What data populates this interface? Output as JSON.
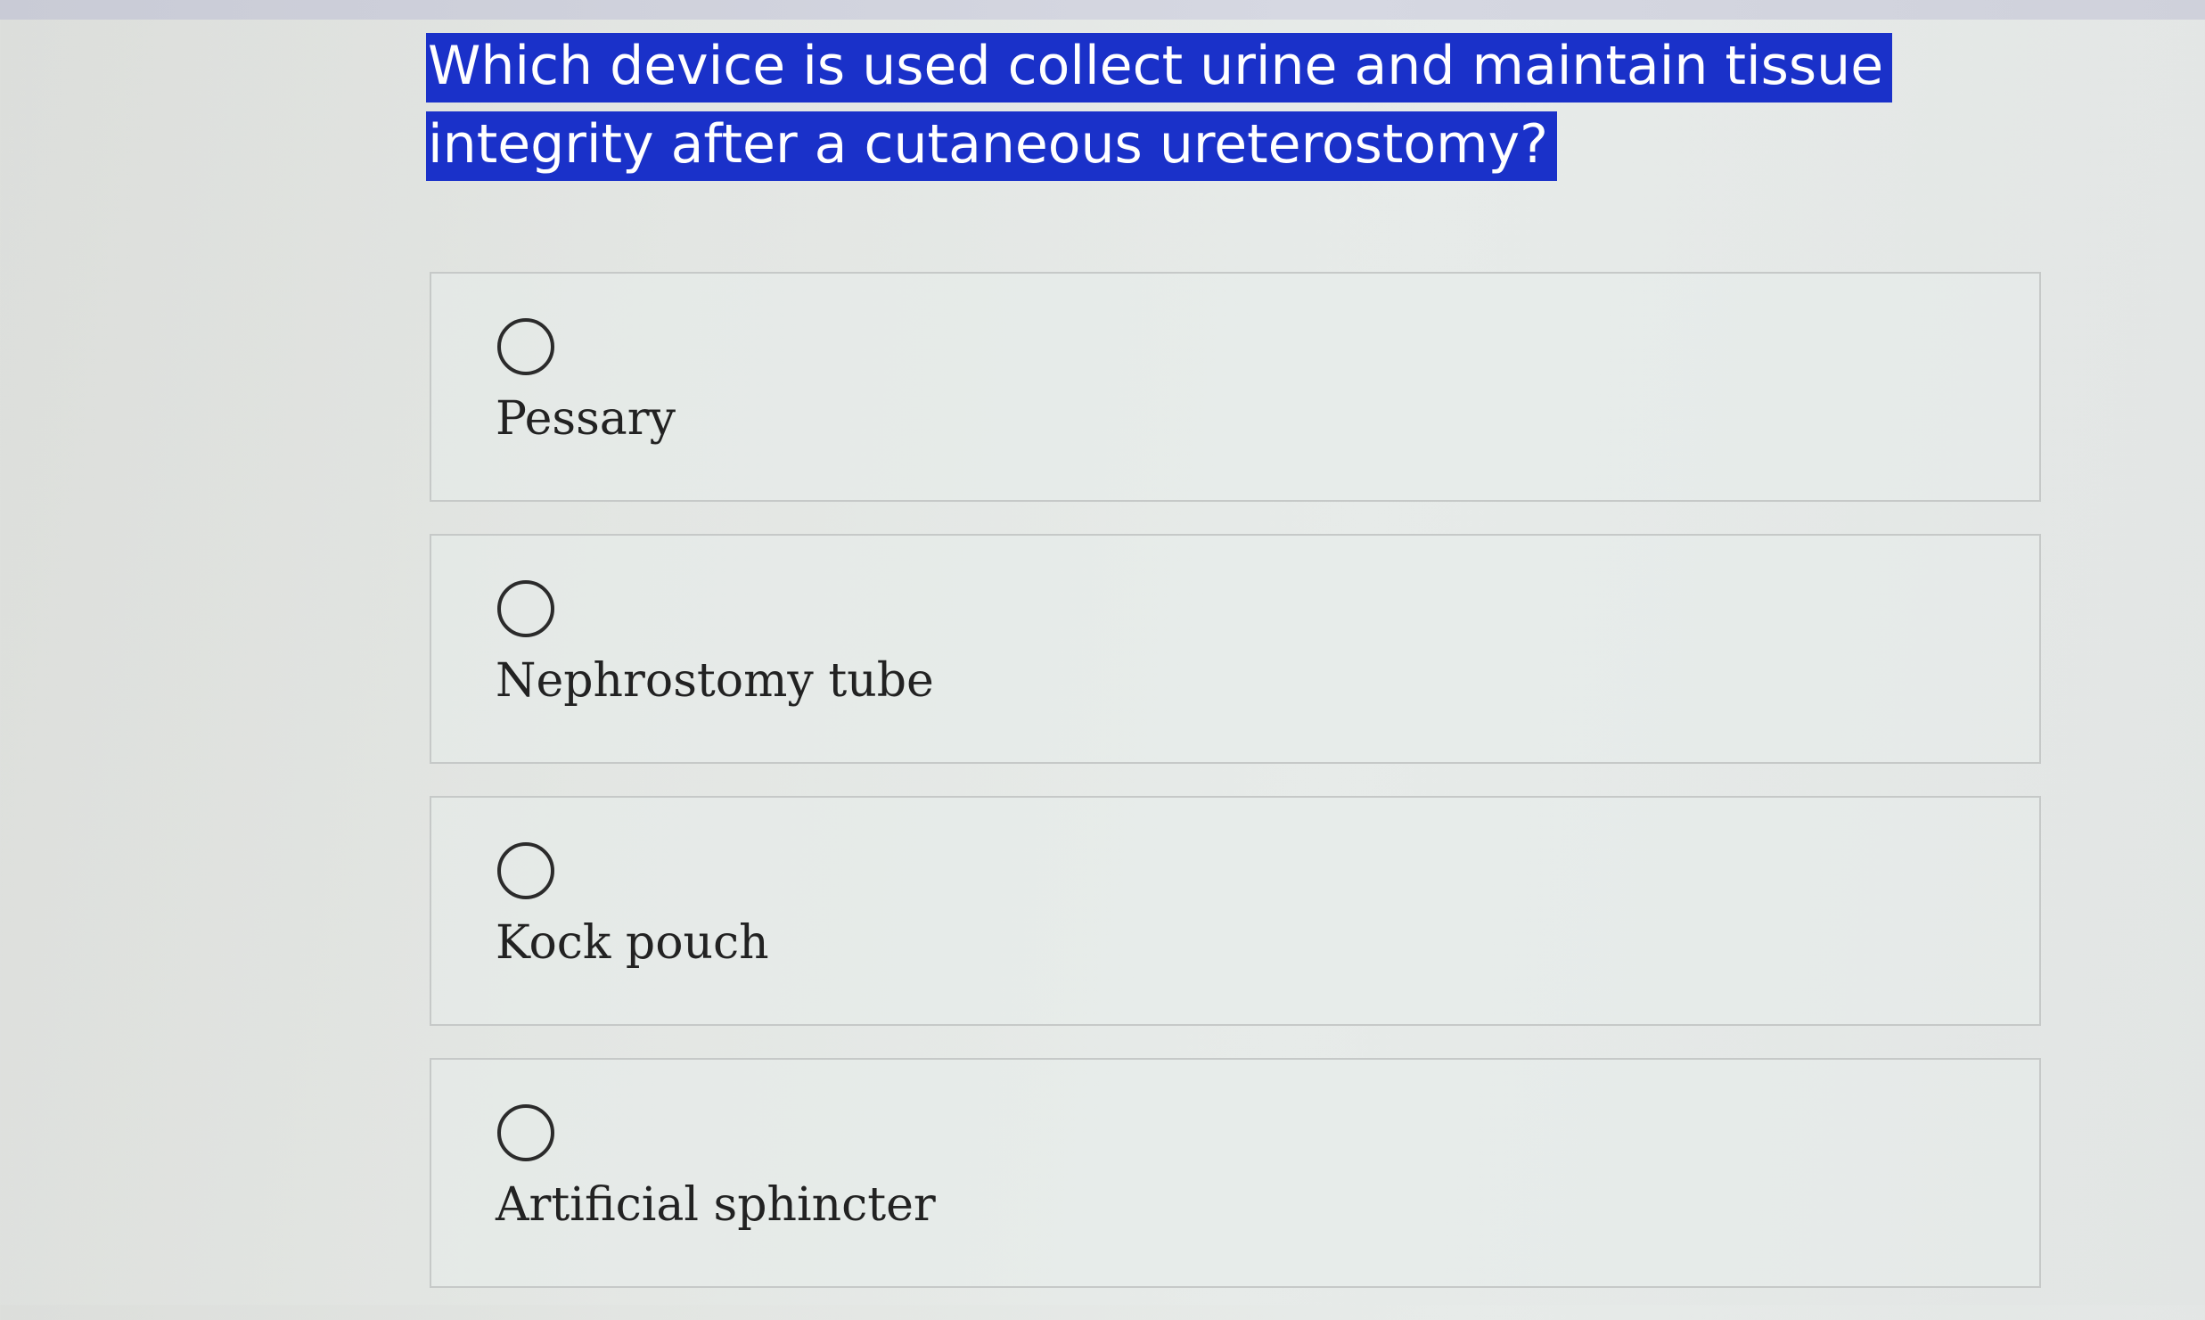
{
  "question": {
    "text": "Which device is used collect urine and maintain tissue integrity after a cutaneous ureterostomy?"
  },
  "options": [
    {
      "label": "Pessary"
    },
    {
      "label": "Nephrostomy tube"
    },
    {
      "label": "Kock pouch"
    },
    {
      "label": "Artificial sphincter"
    }
  ],
  "colors": {
    "highlight": "#1a31c9",
    "highlight_text": "#ffffff",
    "background": "#e3e6e3"
  }
}
